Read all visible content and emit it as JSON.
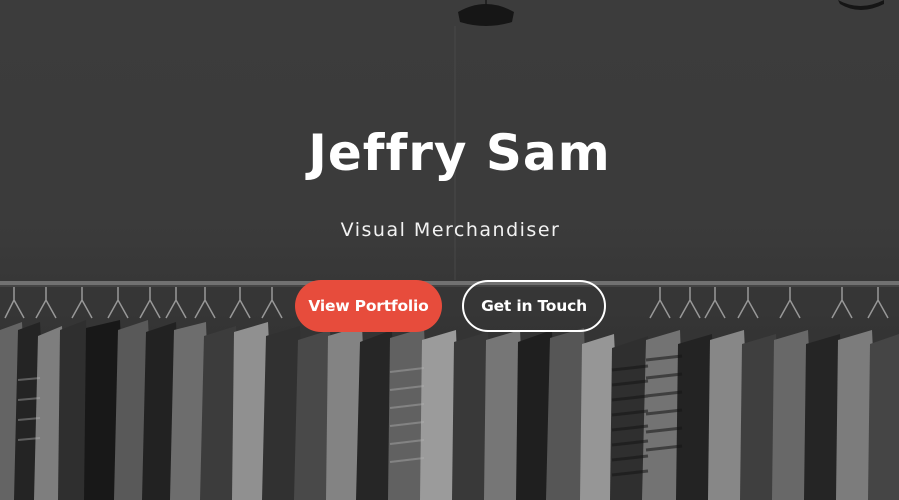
{
  "hero": {
    "name": "Jeffry Sam",
    "role": "Visual Merchandiser"
  },
  "actions": {
    "primary_label": "View Portfolio",
    "secondary_label": "Get in Touch"
  },
  "colors": {
    "primary_button": "#e74c3c",
    "text": "#ffffff"
  }
}
